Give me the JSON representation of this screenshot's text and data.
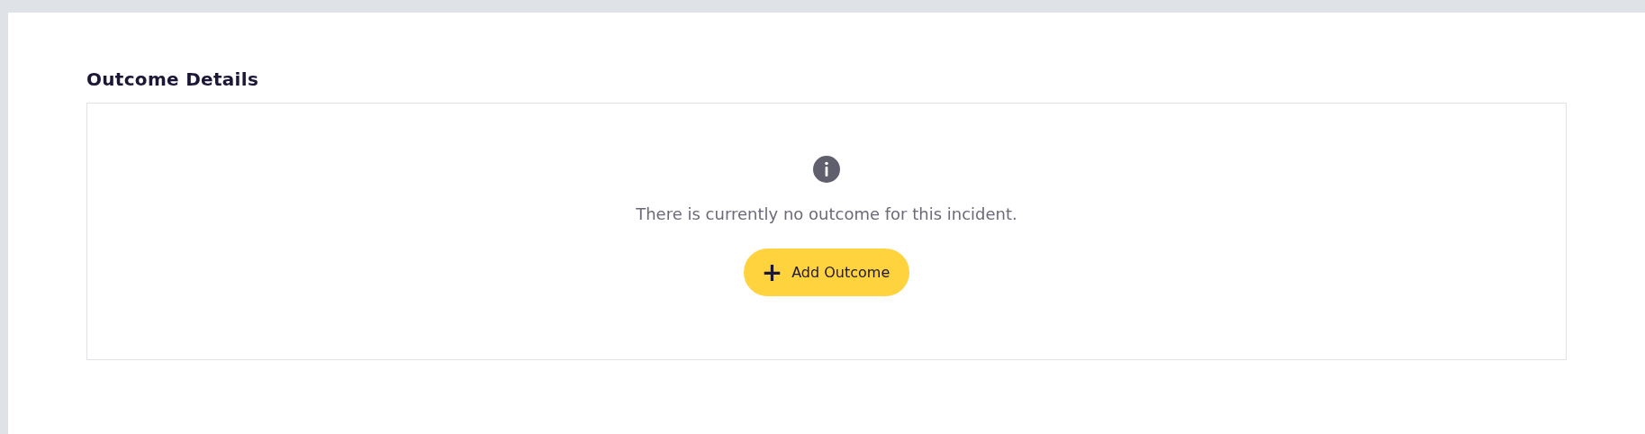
{
  "section": {
    "title": "Outcome Details"
  },
  "empty_state": {
    "message": "There is currently no outcome for this incident.",
    "button": {
      "icon": "+",
      "label": "Add Outcome"
    }
  }
}
